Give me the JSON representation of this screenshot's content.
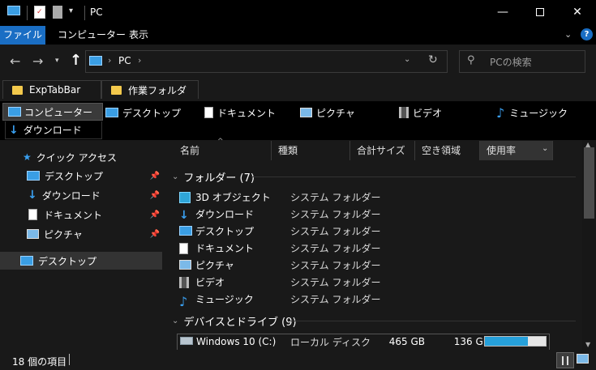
{
  "window": {
    "title": "PC"
  },
  "ribbon": {
    "tabs": [
      "ファイル",
      "コンピューター",
      "表示"
    ]
  },
  "address": {
    "crumb": "PC",
    "search_placeholder": "PCの検索"
  },
  "tabbar": {
    "tabs": [
      "ExpTabBar",
      "作業フォルダ"
    ]
  },
  "linkbar": {
    "items": [
      "コンピューター",
      "デスクトップ",
      "ドキュメント",
      "ピクチャ",
      "ビデオ",
      "ミュージック",
      "ダウンロード"
    ]
  },
  "navpane": {
    "quick_access": "クイック アクセス",
    "items": [
      "デスクトップ",
      "ダウンロード",
      "ドキュメント",
      "ピクチャ"
    ],
    "selected": "デスクトップ"
  },
  "columns": [
    "名前",
    "種類",
    "合計サイズ",
    "空き領域",
    "使用率"
  ],
  "folders_group": "フォルダー (7)",
  "folders": [
    {
      "name": "3D オブジェクト",
      "type": "システム フォルダー",
      "icon": "cube-icon"
    },
    {
      "name": "ダウンロード",
      "type": "システム フォルダー",
      "icon": "download-icon"
    },
    {
      "name": "デスクトップ",
      "type": "システム フォルダー",
      "icon": "desktop-icon"
    },
    {
      "name": "ドキュメント",
      "type": "システム フォルダー",
      "icon": "document-icon"
    },
    {
      "name": "ピクチャ",
      "type": "システム フォルダー",
      "icon": "picture-icon"
    },
    {
      "name": "ビデオ",
      "type": "システム フォルダー",
      "icon": "video-icon"
    },
    {
      "name": "ミュージック",
      "type": "システム フォルダー",
      "icon": "music-icon"
    }
  ],
  "drives_group": "デバイスとドライブ (9)",
  "drives": [
    {
      "name": "Windows 10 (C:)",
      "type": "ローカル ディスク",
      "total": "465 GB",
      "free": "136 GB",
      "usage_fraction": 0.71
    }
  ],
  "status": {
    "count": "18 個の項目"
  },
  "colors": {
    "accent": "#1a6ec4",
    "usage_bar": "#26a0da"
  }
}
